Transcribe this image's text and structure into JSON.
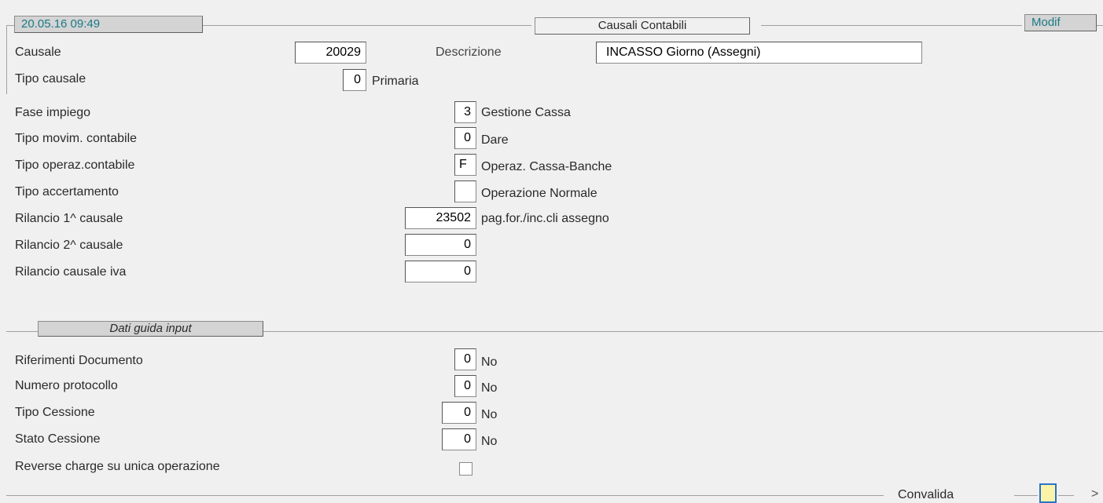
{
  "header": {
    "datetime": "20.05.16 09:49",
    "form_title": "Causali Contabili",
    "mode": "Modif"
  },
  "fields": {
    "causale": {
      "label": "Causale",
      "value": "20029"
    },
    "descrizione": {
      "label": "Descrizione",
      "value": "INCASSO Giorno (Assegni)"
    },
    "tipo_causale": {
      "label": "Tipo causale",
      "value": "0",
      "desc": "Primaria"
    },
    "fase_impiego": {
      "label": "Fase impiego",
      "value": "3",
      "desc": "Gestione Cassa"
    },
    "tipo_movim": {
      "label": "Tipo movim. contabile",
      "value": "0",
      "desc": "Dare"
    },
    "tipo_operaz": {
      "label": "Tipo operaz.contabile",
      "value": "F",
      "desc": "Operaz. Cassa-Banche"
    },
    "tipo_accert": {
      "label": "Tipo accertamento",
      "value": "",
      "desc": "Operazione Normale"
    },
    "rilancio1": {
      "label": "Rilancio 1^ causale",
      "value": "23502",
      "desc": "pag.for./inc.cli assegno"
    },
    "rilancio2": {
      "label": "Rilancio 2^ causale",
      "value": "0"
    },
    "rilancio_iva": {
      "label": "Rilancio causale iva",
      "value": "0"
    }
  },
  "dati_guida": {
    "title": "Dati guida input",
    "riferimenti": {
      "label": "Riferimenti Documento",
      "value": "0",
      "desc": "No"
    },
    "protocollo": {
      "label": "Numero protocollo",
      "value": "0",
      "desc": "No"
    },
    "tipo_cessione": {
      "label": "Tipo  Cessione",
      "value": "0",
      "desc": "No"
    },
    "stato_cessione": {
      "label": "Stato Cessione",
      "value": "0",
      "desc": "No"
    },
    "reverse_charge": {
      "label": "Reverse charge su unica operazione",
      "checked": false
    }
  },
  "footer": {
    "convalida": "Convalida",
    "next_arrow": ">"
  }
}
